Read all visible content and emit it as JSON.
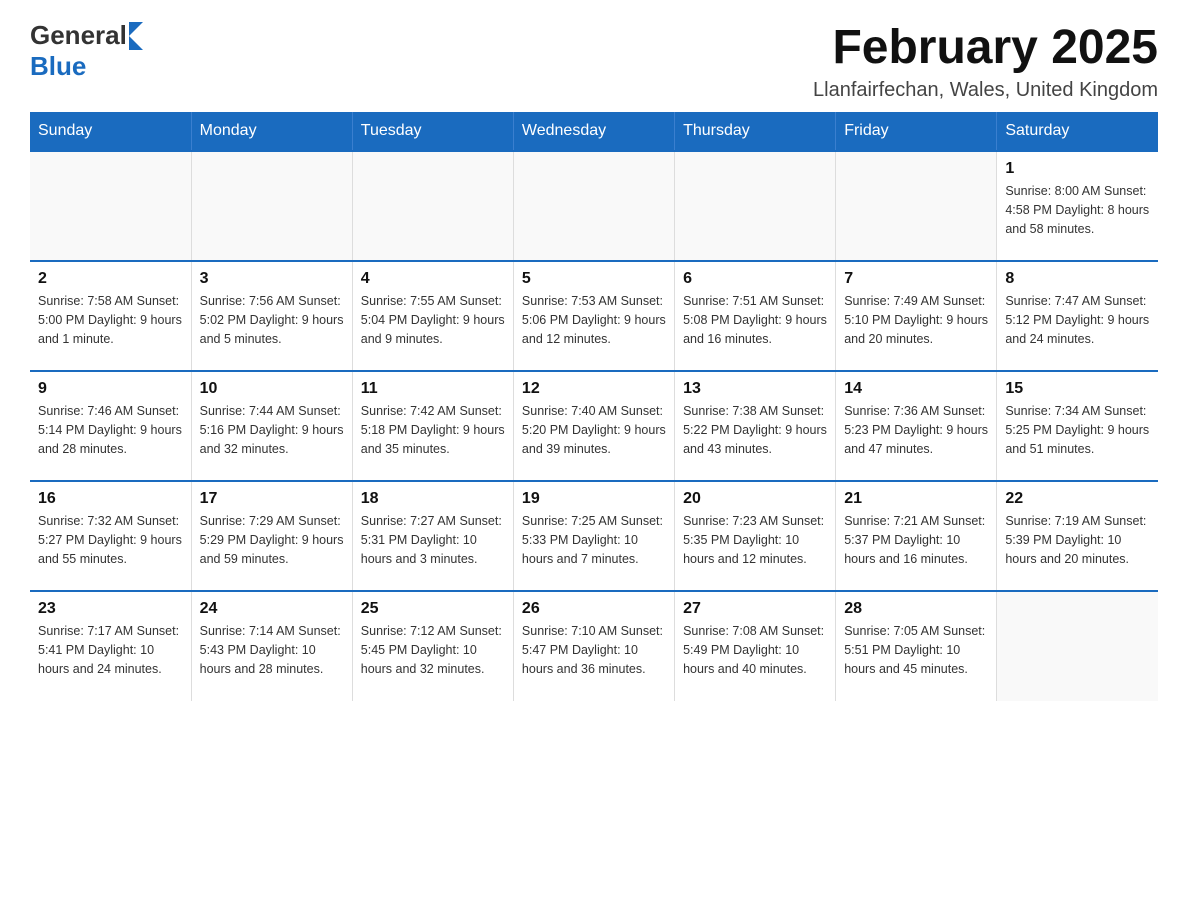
{
  "logo": {
    "general": "General",
    "blue": "Blue"
  },
  "title": "February 2025",
  "subtitle": "Llanfairfechan, Wales, United Kingdom",
  "weekdays": [
    "Sunday",
    "Monday",
    "Tuesday",
    "Wednesday",
    "Thursday",
    "Friday",
    "Saturday"
  ],
  "weeks": [
    [
      {
        "day": "",
        "info": ""
      },
      {
        "day": "",
        "info": ""
      },
      {
        "day": "",
        "info": ""
      },
      {
        "day": "",
        "info": ""
      },
      {
        "day": "",
        "info": ""
      },
      {
        "day": "",
        "info": ""
      },
      {
        "day": "1",
        "info": "Sunrise: 8:00 AM\nSunset: 4:58 PM\nDaylight: 8 hours and 58 minutes."
      }
    ],
    [
      {
        "day": "2",
        "info": "Sunrise: 7:58 AM\nSunset: 5:00 PM\nDaylight: 9 hours and 1 minute."
      },
      {
        "day": "3",
        "info": "Sunrise: 7:56 AM\nSunset: 5:02 PM\nDaylight: 9 hours and 5 minutes."
      },
      {
        "day": "4",
        "info": "Sunrise: 7:55 AM\nSunset: 5:04 PM\nDaylight: 9 hours and 9 minutes."
      },
      {
        "day": "5",
        "info": "Sunrise: 7:53 AM\nSunset: 5:06 PM\nDaylight: 9 hours and 12 minutes."
      },
      {
        "day": "6",
        "info": "Sunrise: 7:51 AM\nSunset: 5:08 PM\nDaylight: 9 hours and 16 minutes."
      },
      {
        "day": "7",
        "info": "Sunrise: 7:49 AM\nSunset: 5:10 PM\nDaylight: 9 hours and 20 minutes."
      },
      {
        "day": "8",
        "info": "Sunrise: 7:47 AM\nSunset: 5:12 PM\nDaylight: 9 hours and 24 minutes."
      }
    ],
    [
      {
        "day": "9",
        "info": "Sunrise: 7:46 AM\nSunset: 5:14 PM\nDaylight: 9 hours and 28 minutes."
      },
      {
        "day": "10",
        "info": "Sunrise: 7:44 AM\nSunset: 5:16 PM\nDaylight: 9 hours and 32 minutes."
      },
      {
        "day": "11",
        "info": "Sunrise: 7:42 AM\nSunset: 5:18 PM\nDaylight: 9 hours and 35 minutes."
      },
      {
        "day": "12",
        "info": "Sunrise: 7:40 AM\nSunset: 5:20 PM\nDaylight: 9 hours and 39 minutes."
      },
      {
        "day": "13",
        "info": "Sunrise: 7:38 AM\nSunset: 5:22 PM\nDaylight: 9 hours and 43 minutes."
      },
      {
        "day": "14",
        "info": "Sunrise: 7:36 AM\nSunset: 5:23 PM\nDaylight: 9 hours and 47 minutes."
      },
      {
        "day": "15",
        "info": "Sunrise: 7:34 AM\nSunset: 5:25 PM\nDaylight: 9 hours and 51 minutes."
      }
    ],
    [
      {
        "day": "16",
        "info": "Sunrise: 7:32 AM\nSunset: 5:27 PM\nDaylight: 9 hours and 55 minutes."
      },
      {
        "day": "17",
        "info": "Sunrise: 7:29 AM\nSunset: 5:29 PM\nDaylight: 9 hours and 59 minutes."
      },
      {
        "day": "18",
        "info": "Sunrise: 7:27 AM\nSunset: 5:31 PM\nDaylight: 10 hours and 3 minutes."
      },
      {
        "day": "19",
        "info": "Sunrise: 7:25 AM\nSunset: 5:33 PM\nDaylight: 10 hours and 7 minutes."
      },
      {
        "day": "20",
        "info": "Sunrise: 7:23 AM\nSunset: 5:35 PM\nDaylight: 10 hours and 12 minutes."
      },
      {
        "day": "21",
        "info": "Sunrise: 7:21 AM\nSunset: 5:37 PM\nDaylight: 10 hours and 16 minutes."
      },
      {
        "day": "22",
        "info": "Sunrise: 7:19 AM\nSunset: 5:39 PM\nDaylight: 10 hours and 20 minutes."
      }
    ],
    [
      {
        "day": "23",
        "info": "Sunrise: 7:17 AM\nSunset: 5:41 PM\nDaylight: 10 hours and 24 minutes."
      },
      {
        "day": "24",
        "info": "Sunrise: 7:14 AM\nSunset: 5:43 PM\nDaylight: 10 hours and 28 minutes."
      },
      {
        "day": "25",
        "info": "Sunrise: 7:12 AM\nSunset: 5:45 PM\nDaylight: 10 hours and 32 minutes."
      },
      {
        "day": "26",
        "info": "Sunrise: 7:10 AM\nSunset: 5:47 PM\nDaylight: 10 hours and 36 minutes."
      },
      {
        "day": "27",
        "info": "Sunrise: 7:08 AM\nSunset: 5:49 PM\nDaylight: 10 hours and 40 minutes."
      },
      {
        "day": "28",
        "info": "Sunrise: 7:05 AM\nSunset: 5:51 PM\nDaylight: 10 hours and 45 minutes."
      },
      {
        "day": "",
        "info": ""
      }
    ]
  ]
}
